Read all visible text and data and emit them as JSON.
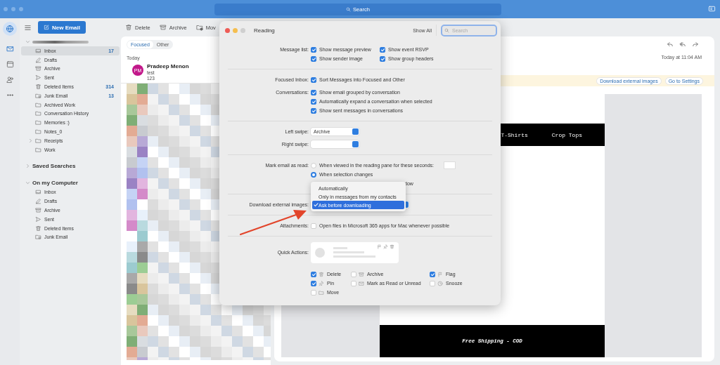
{
  "titlebar": {
    "search": "Search"
  },
  "rail": [
    {
      "kind": "globe",
      "selected": true
    },
    {
      "kind": "mail",
      "selected": true
    },
    {
      "kind": "calendar",
      "selected": false
    },
    {
      "kind": "people",
      "selected": false
    },
    {
      "kind": "more",
      "selected": false
    }
  ],
  "toolbar": {
    "new_email": "New Email",
    "actions": [
      {
        "kind": "trash",
        "label": "Delete"
      },
      {
        "kind": "archive",
        "label": "Archive"
      },
      {
        "kind": "move",
        "label": "Mov"
      }
    ]
  },
  "folders": [
    {
      "kind": "account",
      "expanded": true,
      "items": [
        {
          "kind": "inbox",
          "name": "Inbox",
          "count": "17",
          "selected": true
        },
        {
          "kind": "drafts",
          "name": "Drafts",
          "selected": false
        },
        {
          "kind": "archive",
          "name": "Archive",
          "selected": false
        },
        {
          "kind": "sent",
          "name": "Sent",
          "selected": false
        },
        {
          "kind": "trash",
          "name": "Deleted Items",
          "count": "314",
          "selected": false
        },
        {
          "kind": "junk",
          "name": "Junk Email",
          "count": "13",
          "selected": false
        },
        {
          "kind": "folder",
          "name": "Archived Work",
          "selected": false
        },
        {
          "kind": "folder",
          "name": "Conversation History",
          "selected": false
        },
        {
          "kind": "folder",
          "name": "Memories :)",
          "selected": false
        },
        {
          "kind": "folder",
          "name": "Notes_0",
          "selected": false
        },
        {
          "kind": "folder",
          "name": "Receipts",
          "expanded": false,
          "selected": false
        },
        {
          "kind": "folder",
          "name": "Work",
          "selected": false
        }
      ]
    },
    {
      "kind": "group",
      "label": "Saved Searches",
      "expanded": false
    },
    {
      "kind": "group",
      "label": "On my Computer",
      "expanded": true,
      "items": [
        {
          "kind": "inbox",
          "name": "Inbox",
          "selected": false
        },
        {
          "kind": "drafts",
          "name": "Drafts",
          "selected": false
        },
        {
          "kind": "archive",
          "name": "Archive",
          "selected": false
        },
        {
          "kind": "sent",
          "name": "Sent",
          "selected": false
        },
        {
          "kind": "trash",
          "name": "Deleted Items",
          "selected": false
        },
        {
          "kind": "junk",
          "name": "Junk Email",
          "selected": false
        }
      ]
    }
  ],
  "message_list": {
    "tabs": [
      {
        "label": "Focused",
        "selected": true
      },
      {
        "label": "Other",
        "selected": false
      }
    ],
    "group": "Today",
    "messages": [
      {
        "initials": "PM",
        "sender": "Pradeep Menon",
        "subject": "test",
        "preview": "123"
      }
    ]
  },
  "reading_pane": {
    "time": "Today at 11:04 AM",
    "banner_buttons": [
      "Download external images",
      "Go to Settings"
    ],
    "nav": [
      "T-Shirts",
      "Crop Tops"
    ],
    "footer": "Free Shipping - COD"
  },
  "dialog": {
    "title": "Reading",
    "show_all": "Show All",
    "search_placeholder": "Search",
    "sections": [
      {
        "rows": [
          {
            "label": "Message list:",
            "kind": "checkgrid",
            "items": [
              {
                "label": "Show message preview",
                "checked": true
              },
              {
                "label": "Show event RSVP",
                "checked": true
              },
              {
                "label": "Show sender image",
                "checked": true
              },
              {
                "label": "Show group headers",
                "checked": true
              }
            ]
          }
        ]
      },
      {
        "rows": [
          {
            "label": "Focused Inbox:",
            "kind": "checks",
            "items": [
              {
                "label": "Sort Messages into Focused and Other",
                "checked": true
              }
            ]
          },
          {
            "label": "Conversations:",
            "kind": "checks",
            "items": [
              {
                "label": "Show email grouped by conversation",
                "checked": true
              },
              {
                "label": "Automatically expand a conversation when selected",
                "checked": true
              },
              {
                "label": "Show sent messages in conversations",
                "checked": true
              }
            ]
          }
        ]
      },
      {
        "rows": [
          {
            "label": "Left swipe:",
            "kind": "popup",
            "value": "Archive"
          },
          {
            "label": "Right swipe:",
            "kind": "popup"
          }
        ]
      },
      {
        "rows": [
          {
            "label": "Mark email as read:",
            "kind": "radios",
            "items": [
              {
                "label": "When viewed in the reading pane for these seconds:",
                "selected": false,
                "field": true
              },
              {
                "label": "When selection changes",
                "selected": true
              }
            ],
            "covered_tail": "dow"
          }
        ]
      },
      {
        "rows": [
          {
            "label": "Download external images:",
            "kind": "menu",
            "options": [
              {
                "label": "Automatically",
                "selected": false
              },
              {
                "label": "Only in messages from my contacts",
                "selected": false
              },
              {
                "label": "Ask before downloading",
                "selected": true
              }
            ]
          }
        ]
      },
      {
        "rows": [
          {
            "label": "Attachments:",
            "kind": "checks",
            "items": [
              {
                "label": "Open files in Microsoft 365 apps for Mac whenever possible",
                "checked": false
              }
            ]
          }
        ]
      },
      {
        "rows": [
          {
            "label": "Quick Actions:",
            "kind": "quick_actions",
            "items": [
              {
                "kind": "trash",
                "label": "Delete",
                "checked": true
              },
              {
                "kind": "archive",
                "label": "Archive",
                "checked": false
              },
              {
                "kind": "flag",
                "label": "Flag",
                "checked": true
              },
              {
                "kind": "pin",
                "label": "Pin",
                "checked": true
              },
              {
                "kind": "mail",
                "label": "Mark as Read or Unread",
                "checked": false
              },
              {
                "kind": "clock",
                "label": "Snooze",
                "checked": false
              },
              {
                "kind": "folder",
                "label": "Move",
                "checked": false
              }
            ]
          }
        ]
      }
    ]
  }
}
